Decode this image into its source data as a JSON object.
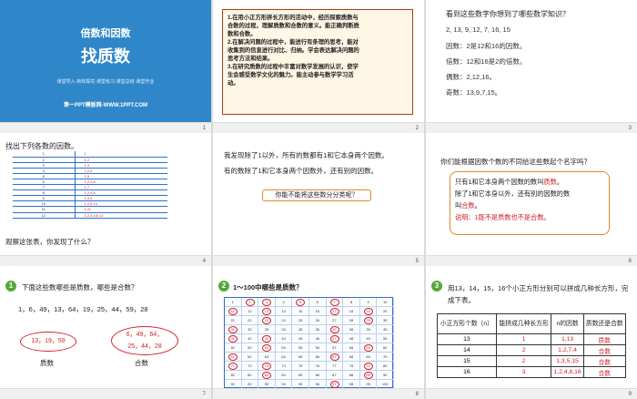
{
  "slide1": {
    "subtitle": "倍数和因数",
    "title": "找质数",
    "menu": "课堂导入·新知探究·课堂练习·课堂总结·课堂作业",
    "site": "第一PPT模板网-WWW.1PPT.COM",
    "num": "1"
  },
  "slide2": {
    "lines": [
      "1.在用小正方形拼长方形的活动中，经历探索质数与",
      "合数的过程，理解质数和合数的意义。能正确判断质",
      "数和合数。",
      "2.在解决问题的过程中，能进行有条理的思考，能对",
      "收集到的信息进行对比、归纳。学会表达解决问题的",
      "思考方法和结果。",
      "3.在研究质数的过程中丰富对数学发展的认识，使学",
      "生会感受数学文化的魅力。能主动参与数学学习活",
      "动。"
    ],
    "num": "2"
  },
  "slide3": {
    "question": "看到这些数字你想到了哪些数学知识？",
    "numbers": "2, 13, 9, 12, 7, 16, 15",
    "factors": "因数：2是12和16的因数。",
    "multiples": "倍数：12和16是2的倍数。",
    "even": "偶数：2,12,16。",
    "odd": "奇数：13,9,7,15。",
    "num": "3"
  },
  "slide4": {
    "question": "找出下列各数的因数。",
    "rows": [
      {
        "n": "1",
        "f": "1"
      },
      {
        "n": "2",
        "f": "1,2"
      },
      {
        "n": "3",
        "f": "1,3"
      },
      {
        "n": "4",
        "f": "1,2,4"
      },
      {
        "n": "5",
        "f": "1,5"
      },
      {
        "n": "6",
        "f": "1,2,3,6"
      },
      {
        "n": "7",
        "f": "1,7"
      },
      {
        "n": "8",
        "f": "1,2,4,8"
      },
      {
        "n": "9",
        "f": "1,3,9"
      },
      {
        "n": "10",
        "f": "1,2,5,10"
      },
      {
        "n": "11",
        "f": "1,11"
      },
      {
        "n": "12",
        "f": "1,2,3,4,6,12"
      }
    ],
    "bottom": "观察这张表，你发现了什么？",
    "num": "4"
  },
  "slide5": {
    "p1": "我发现除了1以外，所有的数都有1和它本身两个因数。",
    "p2": "有的数除了1和它本身两个因数外，还有别的因数。",
    "bubble": "你能不能将这些数分分类呢？",
    "num": "5"
  },
  "slide6": {
    "question": "你们能根据因数个数的不同给这些数起个名字吗？",
    "l1a": "只有1和它本身两个因数的数叫",
    "l1b": "质数",
    "l1c": "。",
    "l2": "除了1和它本身以外，还有别的因数的数",
    "l3a": "叫",
    "l3b": "合数",
    "l3c": "。",
    "note": "说明：1既不是质数也不是合数。",
    "num": "6"
  },
  "slide7": {
    "badge": "1",
    "question": "下面这些数哪些是质数，哪些是合数？",
    "numbers": "1，6，49，13，64，19，25，44，59，28",
    "primes": "13，19，59",
    "composites1": "6，49，64，",
    "composites2": "25，44，28",
    "label_prime": "质数",
    "label_composite": "合数",
    "num": "7"
  },
  "slide8": {
    "badge": "2",
    "question": "1～100中哪些是质数？",
    "num": "8"
  },
  "slide9": {
    "badge": "3",
    "question": "用13，14，15，16个小正方形分别可以拼成几种长方形，完成下表。",
    "headers": [
      "小正方形个数（n）",
      "能拼成几种长方形",
      "n的因数",
      "质数还是合数"
    ],
    "rows": [
      {
        "n": "13",
        "k": "1",
        "f": "1,13",
        "t": "质数"
      },
      {
        "n": "14",
        "k": "2",
        "f": "1,2,7,4",
        "t": "合数"
      },
      {
        "n": "15",
        "k": "2",
        "f": "1,3,5,15",
        "t": "合数"
      },
      {
        "n": "16",
        "k": "3",
        "f": "1,2,4,8,16",
        "t": "合数"
      }
    ],
    "num": "9"
  }
}
